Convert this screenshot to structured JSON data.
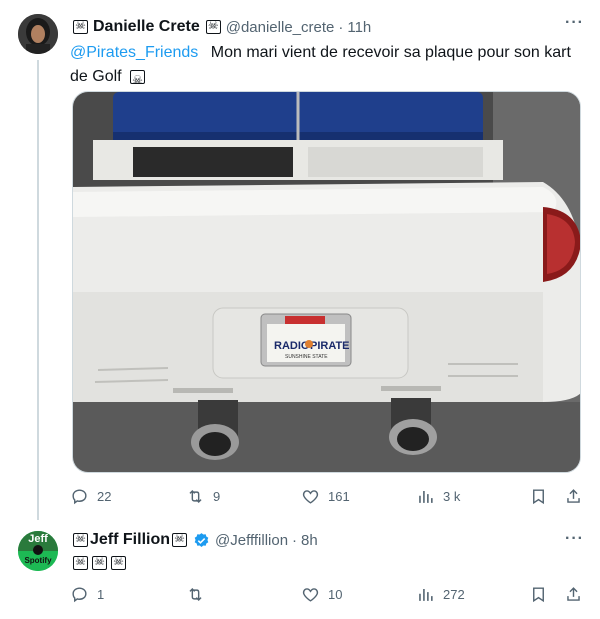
{
  "tweet1": {
    "author_name": "Danielle Crete",
    "handle": "@danielle_crete",
    "separator": "·",
    "time": "11h",
    "mention": "@Pirates_Friends",
    "text": "Mon mari vient de recevoir sa plaque pour son kart de Golf",
    "plate": {
      "top": "RADIO",
      "right": "PIRATE",
      "bottom": "SUNSHINE STATE"
    },
    "stats": {
      "replies": "22",
      "retweets": "9",
      "likes": "161",
      "views": "3 k"
    }
  },
  "tweet2": {
    "author_name": "Jeff Fillion",
    "handle": "@Jefffillion",
    "separator": "·",
    "time": "8h",
    "avatar_text_top": "Jeff",
    "avatar_text_bottom": "Spotify",
    "stats": {
      "replies": "1",
      "retweets": "",
      "likes": "10",
      "views": "272"
    }
  },
  "icons": {
    "more": "more-icon",
    "reply": "reply-icon",
    "retweet": "retweet-icon",
    "like": "heart-icon",
    "views": "views-icon",
    "bookmark": "bookmark-icon",
    "share": "share-icon",
    "verified": "verified-badge-icon",
    "skull": "skull-flag-icon"
  },
  "colors": {
    "link": "#1d9bf0",
    "muted": "#536471",
    "verified": "#1d9bf0",
    "spotify": "#1db954"
  }
}
